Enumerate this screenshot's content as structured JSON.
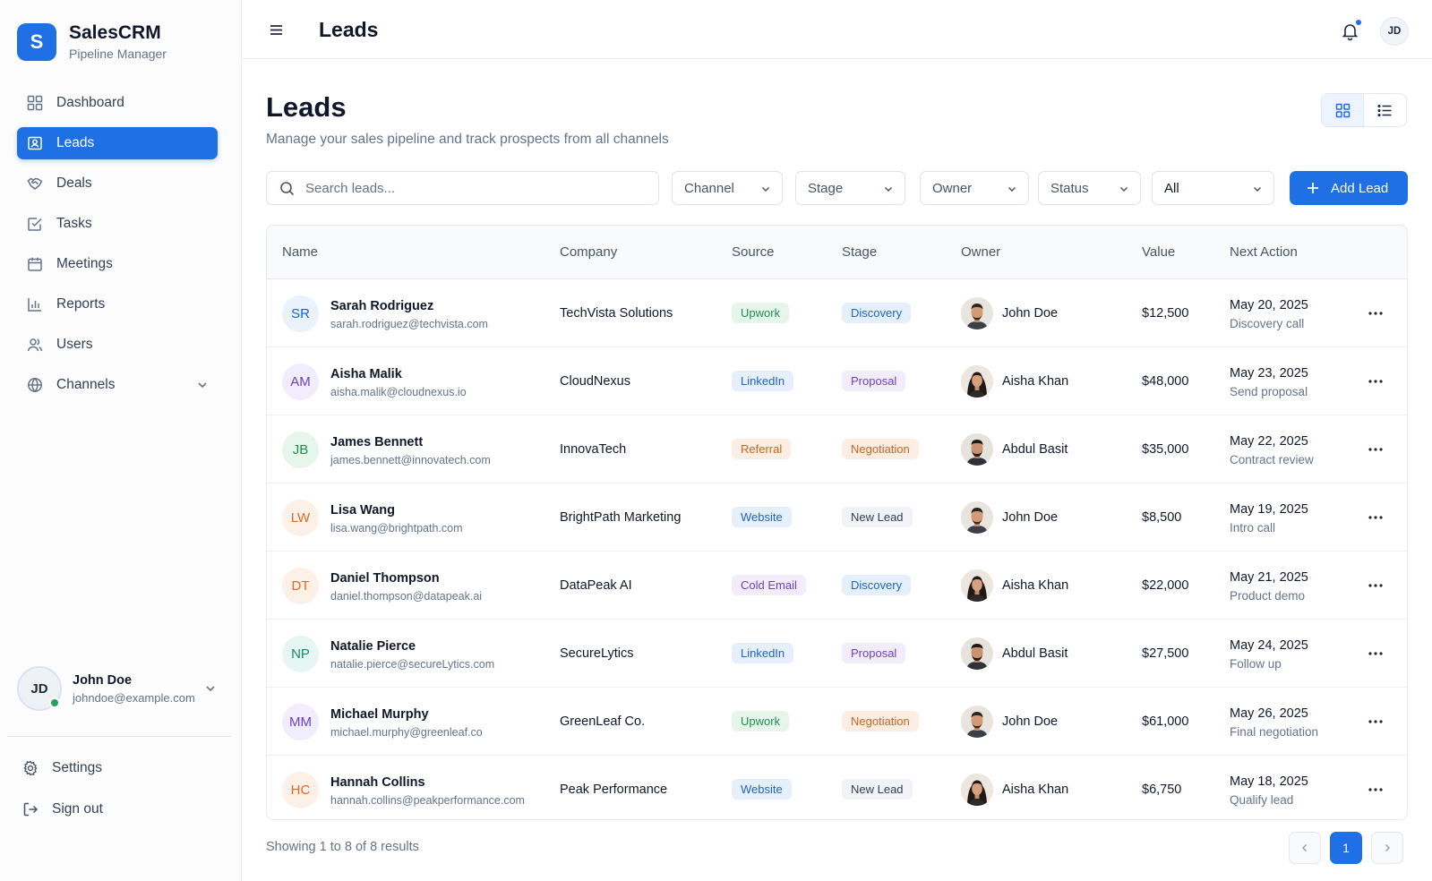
{
  "brand": {
    "logo_letter": "S",
    "name": "SalesCRM",
    "subtitle": "Pipeline Manager",
    "color": "#1f6fe5"
  },
  "sidebar": {
    "items": [
      {
        "label": "Dashboard",
        "icon": "grid-icon"
      },
      {
        "label": "Leads",
        "icon": "contact-card-icon",
        "active": true
      },
      {
        "label": "Deals",
        "icon": "handshake-icon"
      },
      {
        "label": "Tasks",
        "icon": "checkbox-icon"
      },
      {
        "label": "Meetings",
        "icon": "calendar-icon"
      },
      {
        "label": "Reports",
        "icon": "bar-chart-icon"
      },
      {
        "label": "Users",
        "icon": "users-icon"
      },
      {
        "label": "Channels",
        "icon": "globe-icon",
        "expandable": true
      }
    ],
    "user": {
      "initials": "JD",
      "name": "John Doe",
      "email": "johndoe@example.com",
      "status": "online"
    },
    "settings_label": "Settings",
    "signout_label": "Sign out"
  },
  "topbar": {
    "title": "Leads",
    "avatar_initials": "JD",
    "has_notification": true
  },
  "main": {
    "title": "Leads",
    "subtitle": "Manage your sales pipeline and track prospects from all channels",
    "view_mode": "grid",
    "search_placeholder": "Search leads...",
    "filters": [
      "Channel",
      "Stage",
      "Owner",
      "Status",
      "All"
    ],
    "add_label": "Add Lead"
  },
  "table": {
    "headers": [
      "Name",
      "Company",
      "Source",
      "Stage",
      "Owner",
      "Value",
      "Next Action"
    ],
    "rows": [
      {
        "initials": "SR",
        "name": "Sarah Rodriguez",
        "email": "sarah.rodriguez@techvista.com",
        "company": "TechVista Solutions",
        "source": "Upwork",
        "stage": "Discovery",
        "owner": "John Doe",
        "value": "$12,500",
        "date": "May 20, 2025",
        "action": "Discovery call",
        "avatar_color": "blue"
      },
      {
        "initials": "AM",
        "name": "Aisha Malik",
        "email": "aisha.malik@cloudnexus.io",
        "company": "CloudNexus",
        "source": "LinkedIn",
        "stage": "Proposal",
        "owner": "Aisha Khan",
        "value": "$48,000",
        "date": "May 23, 2025",
        "action": "Send proposal",
        "avatar_color": "purple"
      },
      {
        "initials": "JB",
        "name": "James Bennett",
        "email": "james.bennett@innovatech.com",
        "company": "InnovaTech",
        "source": "Referral",
        "stage": "Negotiation",
        "owner": "Abdul Basit",
        "value": "$35,000",
        "date": "May 22, 2025",
        "action": "Contract review",
        "avatar_color": "green"
      },
      {
        "initials": "LW",
        "name": "Lisa Wang",
        "email": "lisa.wang@brightpath.com",
        "company": "BrightPath Marketing",
        "source": "Website",
        "stage": "New Lead",
        "owner": "John Doe",
        "value": "$8,500",
        "date": "May 19, 2025",
        "action": "Intro call",
        "avatar_color": "orange"
      },
      {
        "initials": "DT",
        "name": "Daniel Thompson",
        "email": "daniel.thompson@datapeak.ai",
        "company": "DataPeak AI",
        "source": "Cold Email",
        "stage": "Discovery",
        "owner": "Aisha Khan",
        "value": "$22,000",
        "date": "May 21, 2025",
        "action": "Product demo",
        "avatar_color": "orange"
      },
      {
        "initials": "NP",
        "name": "Natalie Pierce",
        "email": "natalie.pierce@secureLytics.com",
        "company": "SecureLytics",
        "source": "LinkedIn",
        "stage": "Proposal",
        "owner": "Abdul Basit",
        "value": "$27,500",
        "date": "May 24, 2025",
        "action": "Follow up",
        "avatar_color": "teal"
      },
      {
        "initials": "MM",
        "name": "Michael Murphy",
        "email": "michael.murphy@greenleaf.co",
        "company": "GreenLeaf Co.",
        "source": "Upwork",
        "stage": "Negotiation",
        "owner": "John Doe",
        "value": "$61,000",
        "date": "May 26, 2025",
        "action": "Final negotiation",
        "avatar_color": "purple"
      },
      {
        "initials": "HC",
        "name": "Hannah Collins",
        "email": "hannah.collins@peakperformance.com",
        "company": "Peak Performance",
        "source": "Website",
        "stage": "New Lead",
        "owner": "Aisha Khan",
        "value": "$6,750",
        "date": "May 18, 2025",
        "action": "Qualify lead",
        "avatar_color": "orange"
      }
    ]
  },
  "footer": {
    "showing": "Showing 1 to 8 of 8 results",
    "current_page": "1"
  },
  "colors": {
    "accent": "#1f6fe5",
    "source": {
      "Upwork": [
        "#e7f6ec",
        "#1f8f4c"
      ],
      "LinkedIn": [
        "#e6f0fd",
        "#1e63c7"
      ],
      "Referral": [
        "#fdeee3",
        "#d2621a"
      ],
      "Website": [
        "#e6f0fd",
        "#1e63c7"
      ],
      "Cold Email": [
        "#f2ecfd",
        "#6d3fc9"
      ]
    },
    "stage": {
      "Discovery": [
        "#e6f0fd",
        "#1e63c7"
      ],
      "Proposal": [
        "#f2ecfd",
        "#6d3fc9"
      ],
      "Negotiation": [
        "#fdeee3",
        "#d2621a"
      ],
      "New Lead": [
        "#f1f3f6",
        "#334155"
      ]
    },
    "avatar": {
      "blue": [
        "#eaf2fe",
        "#1e63c7"
      ],
      "purple": [
        "#f1edfd",
        "#6d3fc9"
      ],
      "green": [
        "#e6f6ec",
        "#1f8f4c"
      ],
      "orange": [
        "#fdf0e6",
        "#dd6b20"
      ],
      "teal": [
        "#e5f6f3",
        "#178a76"
      ]
    }
  }
}
